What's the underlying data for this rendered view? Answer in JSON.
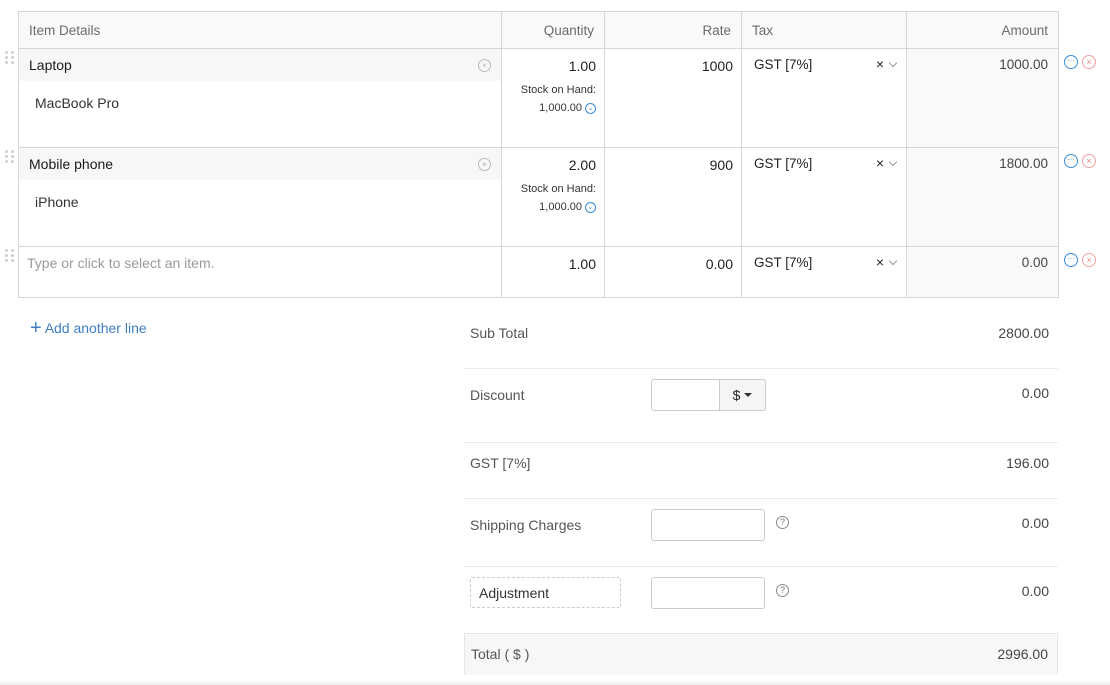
{
  "table": {
    "headers": {
      "item": "Item Details",
      "quantity": "Quantity",
      "rate": "Rate",
      "tax": "Tax",
      "amount": "Amount"
    },
    "rows": [
      {
        "name": "Laptop",
        "description": "MacBook Pro",
        "quantity": "1.00",
        "stock_label": "Stock on Hand:",
        "stock_value": "1,000.00",
        "rate": "1000",
        "tax": "GST [7%]",
        "amount": "1000.00"
      },
      {
        "name": "Mobile phone",
        "description": "iPhone",
        "quantity": "2.00",
        "stock_label": "Stock on Hand:",
        "stock_value": "1,000.00",
        "rate": "900",
        "tax": "GST [7%]",
        "amount": "1800.00"
      },
      {
        "placeholder": "Type or click to select an item.",
        "quantity": "1.00",
        "rate": "0.00",
        "tax": "GST [7%]",
        "amount": "0.00"
      }
    ]
  },
  "icons": {
    "clear": "×",
    "tax_clear": "×",
    "more": "···",
    "remove": "×",
    "stock_toggle": "⌄",
    "help": "?",
    "plus": "+"
  },
  "add_line_label": "Add another line",
  "totals": {
    "sub_total": {
      "label": "Sub Total",
      "value": "2800.00"
    },
    "discount": {
      "label": "Discount",
      "input_value": "",
      "unit": "$",
      "value": "0.00"
    },
    "gst": {
      "label": "GST [7%]",
      "value": "196.00"
    },
    "shipping": {
      "label": "Shipping Charges",
      "input_value": "",
      "value": "0.00"
    },
    "adjustment": {
      "label": "Adjustment",
      "input_value": "",
      "value": "0.00"
    },
    "total": {
      "label": "Total ( $ )",
      "value": "2996.00"
    }
  },
  "colors": {
    "link": "#3f7ec4",
    "more_icon": "#3a8ed8",
    "remove_icon": "#f08080"
  }
}
